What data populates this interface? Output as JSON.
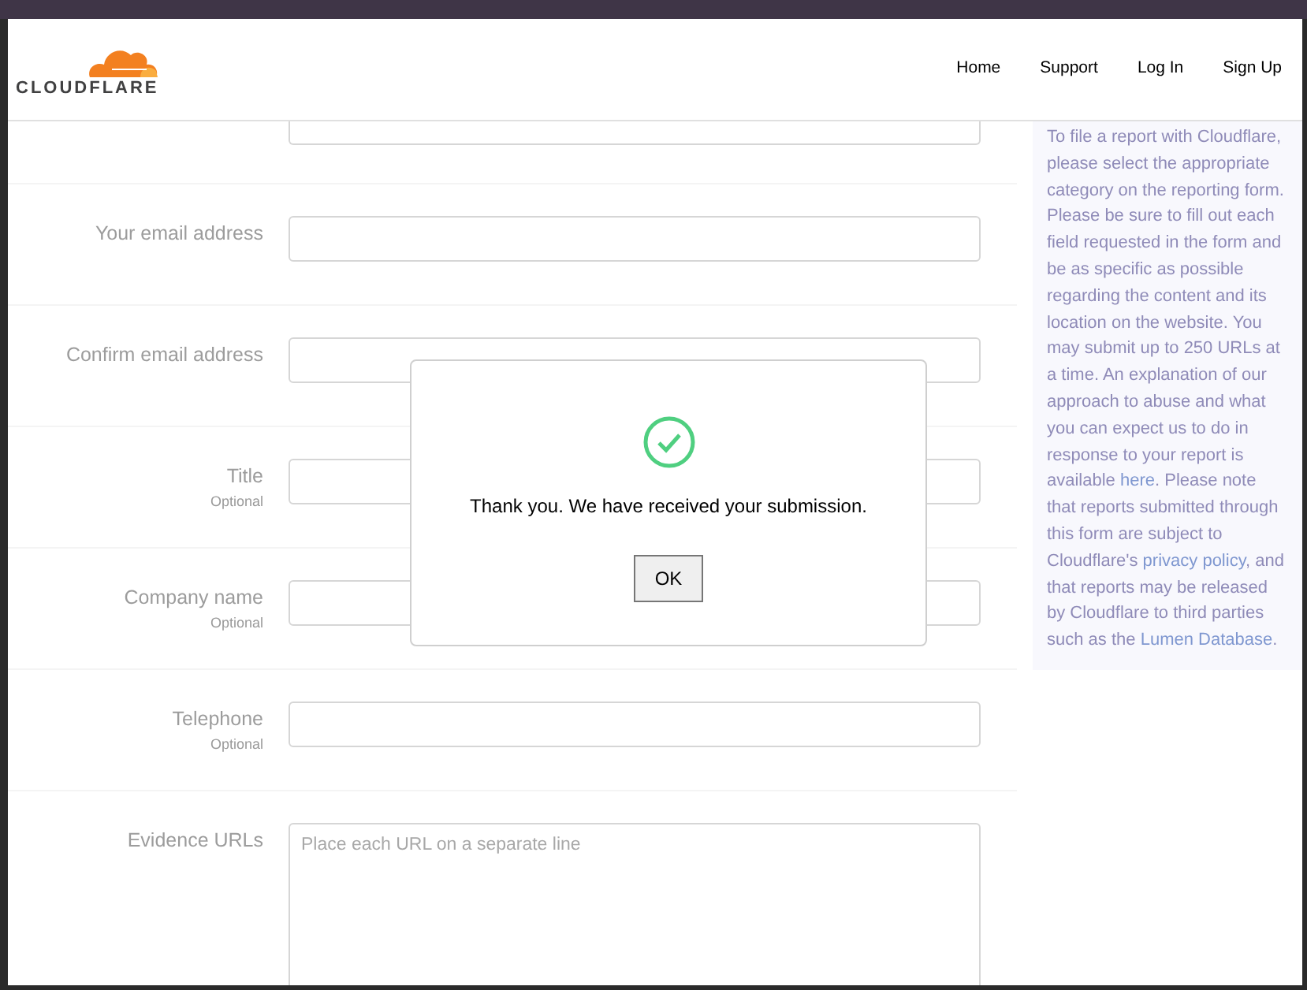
{
  "header": {
    "logo_text": "CLOUDFLARE",
    "nav": [
      "Home",
      "Support",
      "Log In",
      "Sign Up"
    ]
  },
  "form": {
    "fields": [
      {
        "label": "Your email address",
        "kind": "input"
      },
      {
        "label": "Confirm email address",
        "kind": "input"
      },
      {
        "label": "Title",
        "note": "Optional",
        "kind": "input"
      },
      {
        "label": "Company name",
        "note": "Optional",
        "kind": "input"
      },
      {
        "label": "Telephone",
        "note": "Optional",
        "kind": "input"
      },
      {
        "label": "Evidence URLs",
        "kind": "textarea",
        "placeholder": "Place each URL on a separate line"
      }
    ]
  },
  "sidebar": {
    "paragraph": [
      {
        "kind": "text",
        "text": "To file a report with Cloudflare, please select the appropriate category on the reporting form. Please be sure to fill out each field requested in the form and be as specific as possible regarding the content and its location on the website. You may submit up to 250 URLs at a time. An explanation of our approach to abuse and what you can expect us to do in response to your report is available "
      },
      {
        "kind": "link",
        "text": "here"
      },
      {
        "kind": "text",
        "text": ". Please note that reports submitted through this form are subject to Cloudflare's "
      },
      {
        "kind": "link",
        "text": "privacy policy"
      },
      {
        "kind": "text",
        "text": ", and that reports may be released by Cloudflare to third parties such as the "
      },
      {
        "kind": "link",
        "text": "Lumen Database"
      },
      {
        "kind": "text",
        "text": "."
      }
    ]
  },
  "dialog": {
    "message": "Thank you. We have received your submission.",
    "button": "OK"
  }
}
